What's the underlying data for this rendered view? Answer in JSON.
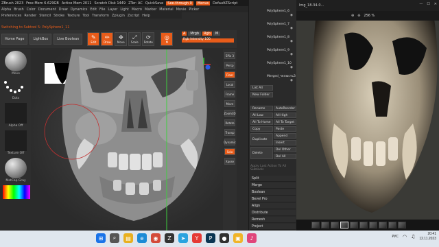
{
  "zbrush": {
    "title_items": [
      "ZBrush 2023",
      "Free Mem 6.629GB",
      "Active Mem 2011",
      "Scratch Disk 1449",
      "ZTer: AC",
      "QuickSave",
      "See-through 0",
      "Menus",
      "DefaultZScript"
    ],
    "menu_row1": [
      "Alpha",
      "Brush",
      "Color",
      "Document",
      "Draw",
      "Dynamics",
      "Edit",
      "File",
      "Layer",
      "Light",
      "Macro",
      "Marker",
      "Material",
      "Movie",
      "Picker"
    ],
    "menu_row2": [
      "Preferences",
      "Render",
      "Stencil",
      "Stroke",
      "Texture",
      "Tool",
      "Transform",
      "Zplugin",
      "Zscript",
      "Help"
    ],
    "subtool_status": "Switching to Subtool 5: PolySphere1_11",
    "shelf": {
      "home_page": "Home Page",
      "lightbox": "LightBox",
      "live_boolean": "Live Boolean",
      "tools": [
        {
          "label": "Edit",
          "glyph": "✎",
          "active": true
        },
        {
          "label": "Draw",
          "glyph": "✏",
          "active": true
        },
        {
          "label": "Move",
          "glyph": "✥",
          "active": false
        },
        {
          "label": "Scale",
          "glyph": "⤢",
          "active": false
        },
        {
          "label": "Rotate",
          "glyph": "⟳",
          "active": false
        }
      ],
      "material_btn": "M",
      "rgb_a": "A",
      "mrgb": "Mrgb",
      "rgb": "Rgb",
      "m": "M",
      "rgb_intensity_label": "Rgb Intensity 100",
      "rgb_intensity_value": 100
    },
    "left_tray": {
      "items": [
        {
          "label": "Move"
        },
        {
          "label": "Dots"
        },
        {
          "label": "Alpha Off"
        },
        {
          "label": "Texture Off"
        },
        {
          "label": "MatCap Gray"
        }
      ]
    },
    "right_toolbar": [
      "SPix 3",
      "Persp",
      "Floor",
      "Local",
      "Frame",
      "Move",
      "Zoom3D",
      "Rotate",
      "Transp",
      "Dynamic",
      "Solo",
      "Xpose"
    ],
    "subtool": {
      "items": [
        {
          "name": "PolySphere1_6"
        },
        {
          "name": "PolySphere1_7"
        },
        {
          "name": "PolySphere1_8"
        },
        {
          "name": "PolySphere1_9"
        },
        {
          "name": "PolySphere1_10"
        },
        {
          "name": "Merged_челюсть3"
        }
      ],
      "list_all": "List All",
      "new_folder": "New Folder",
      "rename": "Rename",
      "autoreorder": "AutoReorder",
      "all_low": "All Low",
      "all_high": "All High",
      "all_to_home": "All To Home",
      "all_to_target": "All To Target",
      "copy": "Copy",
      "paste": "Paste",
      "duplicate": "Duplicate",
      "append": "Append",
      "insert": "Insert",
      "delete": "Delete",
      "del_other": "Del Other",
      "del_all": "Del All",
      "apply_recursive": "Apply Last Action To All Subtools",
      "sections": [
        "Split",
        "Merge",
        "Boolean",
        "Bevel Pro",
        "Align",
        "Distribute",
        "Remesh",
        "Project"
      ]
    }
  },
  "viewer": {
    "filename": "Img_18-34-0...",
    "zoom": "256 %",
    "thumbnail_count": 10
  },
  "taskbar": {
    "icons": [
      {
        "name": "start-icon",
        "color": "#1a73e8",
        "glyph": "⊞"
      },
      {
        "name": "search-icon",
        "color": "#555555",
        "glyph": "⌕"
      },
      {
        "name": "file-explorer-icon",
        "color": "#e8b020",
        "glyph": "▤"
      },
      {
        "name": "edge-icon",
        "color": "#1c8bd6",
        "glyph": "e"
      },
      {
        "name": "chrome-icon",
        "color": "#d34a3a",
        "glyph": "◉"
      },
      {
        "name": "zbrush-icon",
        "color": "#333333",
        "glyph": "Z"
      },
      {
        "name": "telegram-icon",
        "color": "#2aa3df",
        "glyph": "➤"
      },
      {
        "name": "yandex-icon",
        "color": "#e53935",
        "glyph": "Y"
      },
      {
        "name": "photoshop-icon",
        "color": "#0b3552",
        "glyph": "P"
      },
      {
        "name": "obs-icon",
        "color": "#303030",
        "glyph": "●"
      },
      {
        "name": "folder-icon",
        "color": "#f0b429",
        "glyph": "▣"
      },
      {
        "name": "music-icon",
        "color": "#e0457b",
        "glyph": "♪"
      }
    ],
    "lang": "РУС",
    "time": "20:41",
    "date": "12.11.2023"
  }
}
